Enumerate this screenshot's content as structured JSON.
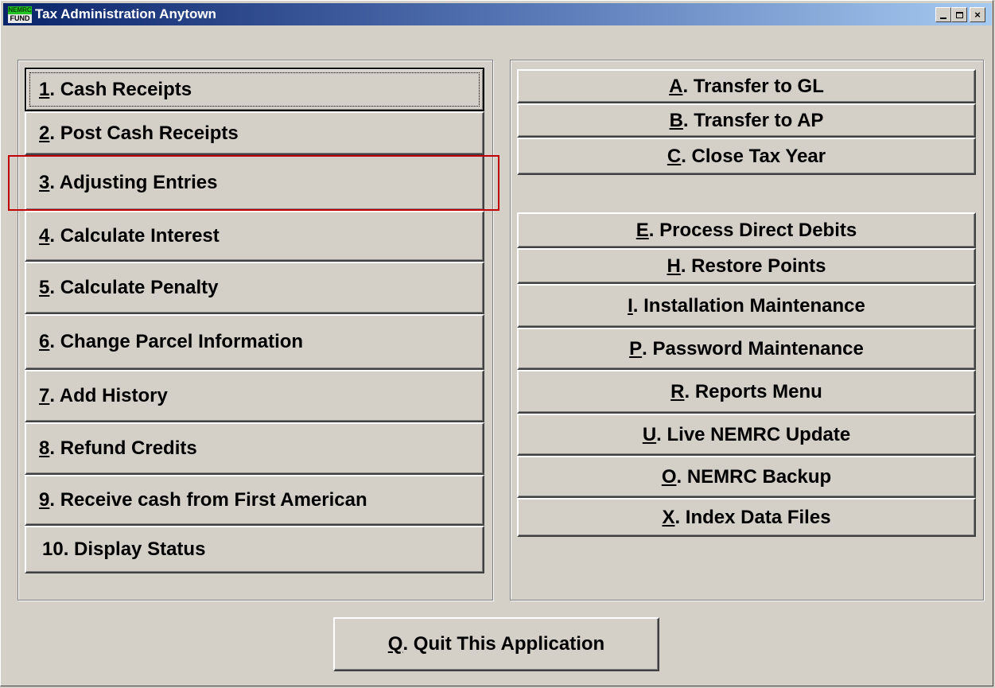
{
  "window": {
    "title": "Tax Administration Anytown",
    "icon_top": "NEMRC",
    "icon_bottom": "FUND"
  },
  "controls": {
    "minimize": "minimize-icon",
    "maximize": "maximize-icon",
    "close": "close-icon",
    "close_glyph": "×"
  },
  "left_menu": [
    {
      "key": "1",
      "rest": ". Cash Receipts"
    },
    {
      "key": "2",
      "rest": ". Post Cash Receipts"
    },
    {
      "key": "3",
      "rest": ". Adjusting Entries"
    },
    {
      "key": "4",
      "rest": ". Calculate Interest"
    },
    {
      "key": "5",
      "rest": ". Calculate Penalty"
    },
    {
      "key": "6",
      "rest": ". Change Parcel Information"
    },
    {
      "key": "7",
      "rest": ". Add History"
    },
    {
      "key": "8",
      "rest": ". Refund Credits"
    },
    {
      "key": "9",
      "rest": ".  Receive cash from First American"
    },
    {
      "key": "",
      "rest": "10. Display Status"
    }
  ],
  "right_menu": [
    {
      "key": "A",
      "rest": ". Transfer to GL"
    },
    {
      "key": "B",
      "rest": ". Transfer to AP"
    },
    {
      "key": "C",
      "rest": ". Close Tax Year"
    },
    {
      "key": "E",
      "rest": ". Process Direct Debits"
    },
    {
      "key": "H",
      "rest": ". Restore Points"
    },
    {
      "key": "I",
      "rest": ". Installation Maintenance"
    },
    {
      "key": "P",
      "rest": ". Password Maintenance"
    },
    {
      "key": "R",
      "rest": ". Reports Menu"
    },
    {
      "key": "U",
      "rest": ". Live NEMRC Update"
    },
    {
      "key": "O",
      "rest": ". NEMRC Backup"
    },
    {
      "key": "X",
      "rest": ". Index Data Files"
    }
  ],
  "quit": {
    "key": "Q",
    "rest": ".  Quit This Application"
  },
  "colors": {
    "face": "#d4d0c8",
    "highlight_box": "#c00000",
    "title_start": "#0a246a",
    "title_end": "#a6caf0"
  }
}
